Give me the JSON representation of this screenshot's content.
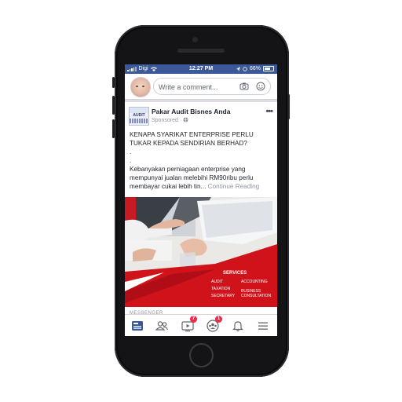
{
  "status_bar": {
    "carrier": "Digi",
    "time": "12:27 PM",
    "battery": "66%"
  },
  "comment_bar": {
    "placeholder": "Write a comment..."
  },
  "post": {
    "page_name": "Pakar Audit Bisnes Anda",
    "sponsored": "Sponsored",
    "logo_text": "AUDIT",
    "headline": "KENAPA SYARIKAT ENTERPRISE PERLU TUKAR KEPADA SENDIRIAN BERHAD?",
    "dot1": ".",
    "dot2": ".",
    "body": "Kebanyakan perniagaan enterprise yang mempunyai jualan melebihi RM90ribu perlu membayar cukai lebih tin...",
    "continue_label": "Continue Reading",
    "image": {
      "services_title": "SERVICES",
      "services_left": [
        "AUDIT",
        "TAXATION",
        "SECRETARY"
      ],
      "services_right": [
        "ACCOUNTING",
        "BUSINESS",
        "CONSULTATION"
      ]
    }
  },
  "messenger_label": "MESSENGER",
  "tabbar": {
    "watch_badge": "7",
    "groups_badge": "1"
  },
  "colors": {
    "brand": "#3b5998",
    "accent_red": "#d0121b",
    "badge": "#f02849"
  }
}
